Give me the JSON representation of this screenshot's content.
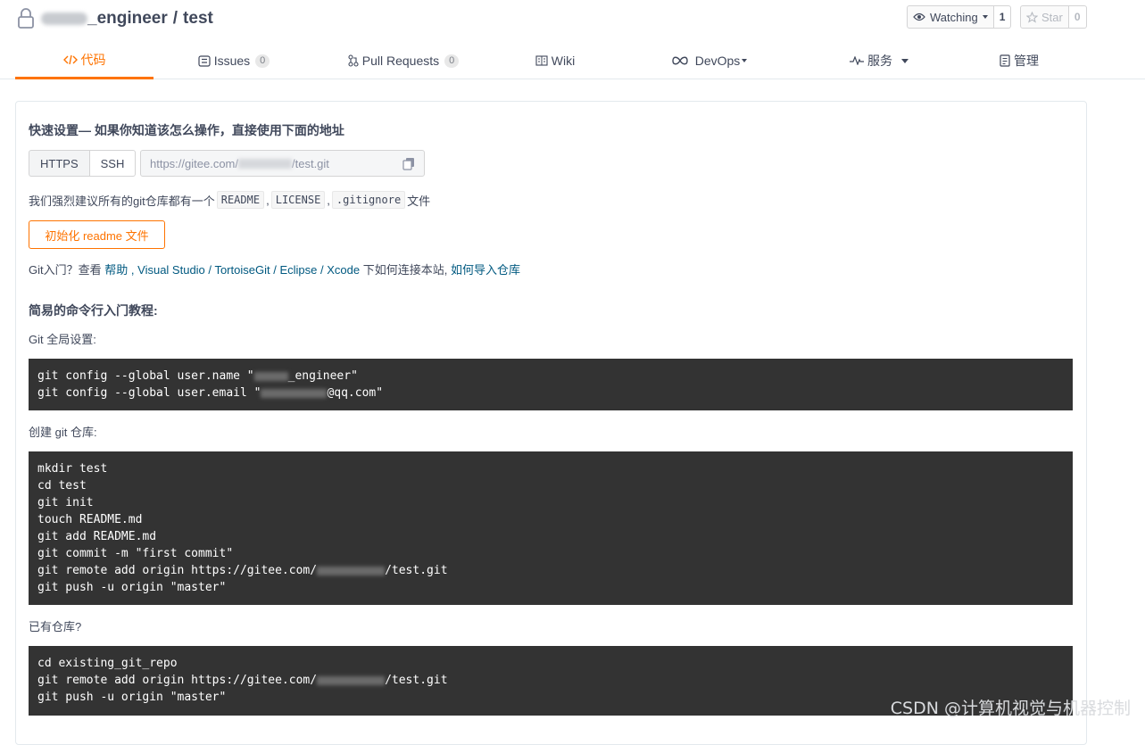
{
  "repo": {
    "name": "_engineer",
    "separator": "/",
    "project": "test"
  },
  "actions": {
    "watch_label": "Watching",
    "watch_count": "1",
    "star_label": "Star",
    "star_count": "0"
  },
  "tabs": [
    {
      "label": "代码",
      "icon": "code-icon"
    },
    {
      "label": "Issues",
      "badge": "0",
      "icon": "issues-icon"
    },
    {
      "label": "Pull Requests",
      "badge": "0",
      "icon": "pull-request-icon"
    },
    {
      "label": "Wiki",
      "icon": "wiki-icon"
    },
    {
      "label": "DevOps",
      "icon": "infinity-icon"
    },
    {
      "label": "服务",
      "icon": "pulse-icon"
    },
    {
      "label": "管理",
      "icon": "manage-icon"
    }
  ],
  "quick_setup": {
    "title": "快速设置— 如果你知道该怎么操作，直接使用下面的地址",
    "https_label": "HTTPS",
    "ssh_label": "SSH",
    "url_prefix": "https://gitee.com/",
    "url_suffix": "/test.git",
    "recommend_prefix": "我们强烈建议所有的git仓库都有一个",
    "readme": "README",
    "license": "LICENSE",
    "gitignore": ".gitignore",
    "comma": ",",
    "recommend_suffix": "文件",
    "init_button": "初始化 readme 文件"
  },
  "git_intro": {
    "prefix": "Git入门？查看",
    "help": "帮助",
    "sep1": ",",
    "vs": "Visual Studio",
    "slash": "/",
    "tortoise": "TortoiseGit",
    "eclipse": "Eclipse",
    "xcode": "Xcode",
    "middle": "下如何连接本站,",
    "import": "如何导入仓库"
  },
  "tutorial": {
    "title": "简易的命令行入门教程:",
    "global_label": "Git 全局设置:",
    "global_lines": [
      "git config --global user.name \"",
      "_engineer\"",
      "git config --global user.email \"",
      "@qq.com\""
    ],
    "create_label": "创建 git 仓库:",
    "create_lines": [
      "mkdir test",
      "cd test",
      "git init",
      "touch README.md",
      "git add README.md",
      "git commit -m \"first commit\"",
      "git remote add origin https://gitee.com/",
      "/test.git",
      "git push -u origin \"master\""
    ],
    "existing_label": "已有仓库?",
    "existing_lines": [
      "cd existing_git_repo",
      "git remote add origin https://gitee.com/",
      "/test.git",
      "git push -u origin \"master\""
    ]
  },
  "watermark": "CSDN @计算机视觉与机器控制",
  "colors": {
    "accent": "#fe7300",
    "link": "#005980",
    "code_bg": "#333333"
  }
}
